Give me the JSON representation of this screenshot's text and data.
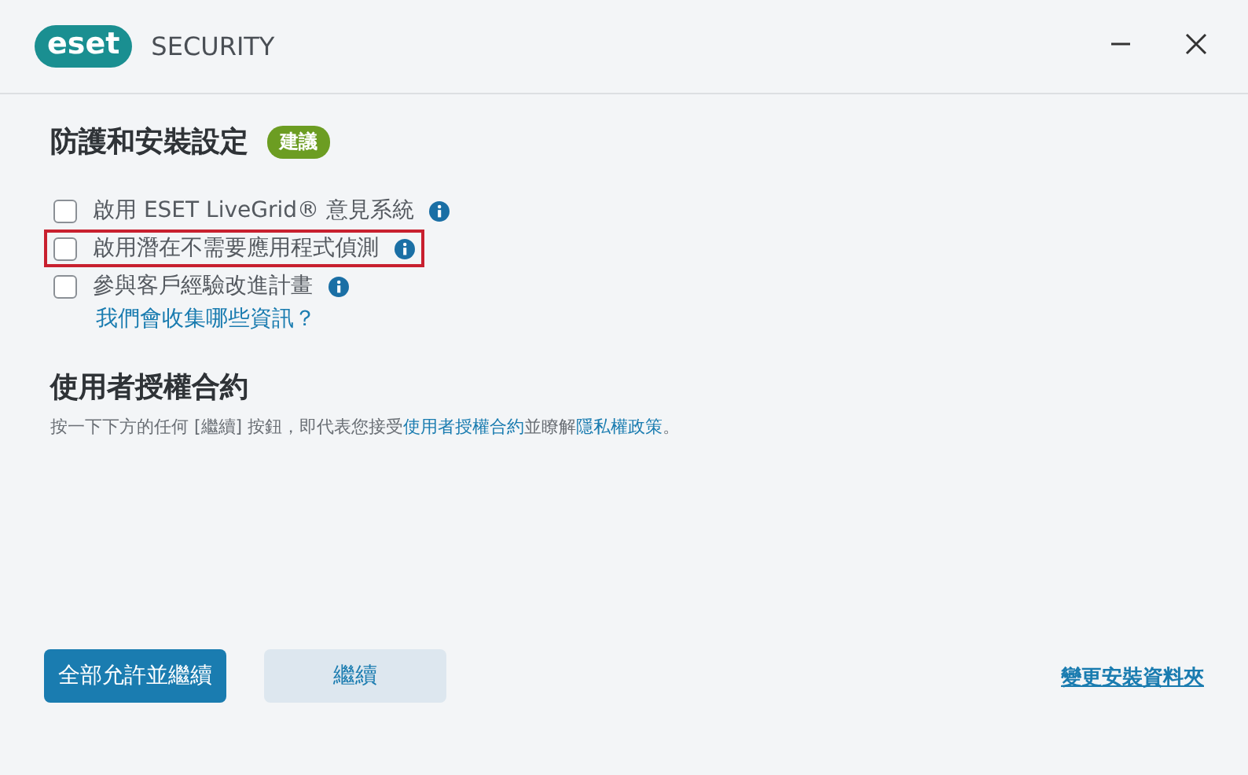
{
  "window": {
    "logo": "eset",
    "product": "SECURITY",
    "controls": [
      {
        "kind": "minimize"
      },
      {
        "kind": "close"
      }
    ]
  },
  "settings": {
    "title": "防護和安裝設定",
    "badge": "建議",
    "options": [
      {
        "label": "啟用 ESET LiveGrid® 意見系統",
        "checked": false,
        "highlighted": false
      },
      {
        "label": "啟用潛在不需要應用程式偵測",
        "checked": false,
        "highlighted": true
      },
      {
        "label": "參與客戶經驗改進計畫",
        "checked": false,
        "highlighted": false,
        "link": "我們會收集哪些資訊？"
      }
    ]
  },
  "license": {
    "title": "使用者授權合約",
    "parts": [
      {
        "kind": "text",
        "text": "按一下下方的任何 [繼續] 按鈕，即代表您接受"
      },
      {
        "kind": "link",
        "text": "使用者授權合約"
      },
      {
        "kind": "text",
        "text": "並瞭解"
      },
      {
        "kind": "link",
        "text": "隱私權政策"
      },
      {
        "kind": "text",
        "text": "。"
      }
    ]
  },
  "footer": {
    "buttons": [
      {
        "label": "全部允許並繼續",
        "kind": "primary"
      },
      {
        "label": "繼續",
        "kind": "secondary"
      }
    ],
    "link": "變更安裝資料夾"
  }
}
